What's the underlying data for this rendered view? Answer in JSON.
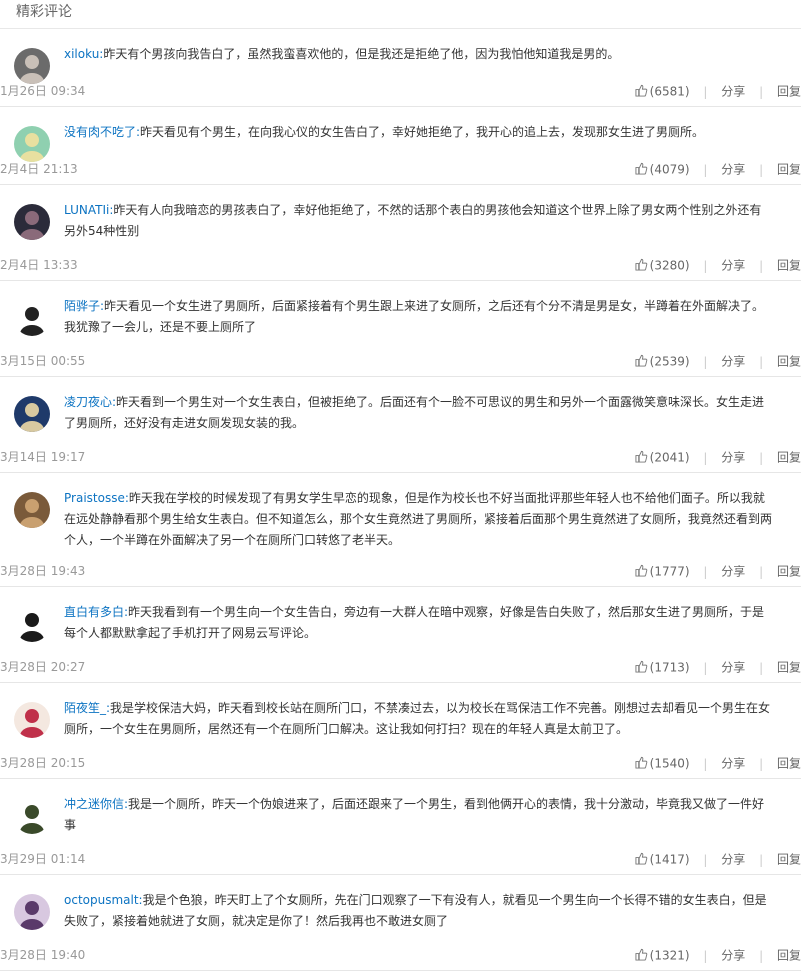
{
  "section_title": "精彩评论",
  "comments": [
    {
      "user": "xiloku:",
      "text": "昨天有个男孩向我告白了，虽然我蛮喜欢他的，但是我还是拒绝了他，因为我怕他知道我是男的。",
      "time": "1月26日 09:34",
      "likes": "(6581)",
      "share": "分享",
      "reply": "回复",
      "avatar_colors": [
        "#6b6b6b",
        "#c9c0b8"
      ]
    },
    {
      "user": "没有肉不吃了:",
      "text": "昨天看见有个男生，在向我心仪的女生告白了，幸好她拒绝了，我开心的追上去，发现那女生进了男厕所。",
      "time": "2月4日 21:13",
      "likes": "(4079)",
      "share": "分享",
      "reply": "回复",
      "avatar_colors": [
        "#8fd0b0",
        "#e8e0a0"
      ]
    },
    {
      "user": "LUNATIi:",
      "text": "昨天有人向我暗恋的男孩表白了，幸好他拒绝了，不然的话那个表白的男孩他会知道这个世界上除了男女两个性别之外还有另外54种性别",
      "time": "2月4日 13:33",
      "likes": "(3280)",
      "share": "分享",
      "reply": "回复",
      "avatar_colors": [
        "#2b2b3a",
        "#8a6a7a"
      ]
    },
    {
      "user": "陌骅子:",
      "text": "昨天看见一个女生进了男厕所，后面紧接着有个男生跟上来进了女厕所，之后还有个分不清是男是女，半蹲着在外面解决了。我犹豫了一会儿，还是不要上厕所了",
      "time": "3月15日 00:55",
      "likes": "(2539)",
      "share": "分享",
      "reply": "回复",
      "avatar_colors": [
        "#ffffff",
        "#222222"
      ]
    },
    {
      "user": "凌刀夜心:",
      "text": "昨天看到一个男生对一个女生表白，但被拒绝了。后面还有个一脸不可思议的男生和另外一个面露微笑意味深长。女生走进了男厕所，还好没有走进女厕发现女装的我。",
      "time": "3月14日 19:17",
      "likes": "(2041)",
      "share": "分享",
      "reply": "回复",
      "avatar_colors": [
        "#1f3a6a",
        "#d8c9a0"
      ]
    },
    {
      "user": "Praistosse:",
      "text": "昨天我在学校的时候发现了有男女学生早恋的现象，但是作为校长也不好当面批评那些年轻人也不给他们面子。所以我就在远处静静看那个男生给女生表白。但不知道怎么，那个女生竟然进了男厕所，紧接着后面那个男生竟然进了女厕所，我竟然还看到两个人，一个半蹲在外面解决了另一个在厕所门口转悠了老半天。",
      "time": "3月28日 19:43",
      "likes": "(1777)",
      "share": "分享",
      "reply": "回复",
      "avatar_colors": [
        "#7a5a3a",
        "#c9a070"
      ]
    },
    {
      "user": "直白有多白:",
      "text": "昨天我看到有一个男生向一个女生告白，旁边有一大群人在暗中观察，好像是告白失败了，然后那女生进了男厕所，于是每个人都默默拿起了手机打开了网易云写评论。",
      "time": "3月28日 20:27",
      "likes": "(1713)",
      "share": "分享",
      "reply": "回复",
      "avatar_colors": [
        "#ffffff",
        "#1a1a1a"
      ]
    },
    {
      "user": "陌夜笙_:",
      "text": "我是学校保洁大妈，昨天看到校长站在厕所门口，不禁凑过去，以为校长在骂保洁工作不完善。刚想过去却看见一个男生在女厕所，一个女生在男厕所，居然还有一个在厕所门口解决。这让我如何打扫？现在的年轻人真是太前卫了。",
      "time": "3月28日 20:15",
      "likes": "(1540)",
      "share": "分享",
      "reply": "回复",
      "avatar_colors": [
        "#f4e8e0",
        "#c0304a"
      ]
    },
    {
      "user": "冲之迷你信:",
      "text": "我是一个厕所，昨天一个伪娘进来了，后面还跟来了一个男生，看到他俩开心的表情，我十分激动，毕竟我又做了一件好事",
      "time": "3月29日 01:14",
      "likes": "(1417)",
      "share": "分享",
      "reply": "回复",
      "avatar_colors": [
        "#ffffff",
        "#3a4a2a"
      ]
    },
    {
      "user": "octopusmalt:",
      "text": "我是个色狼，昨天盯上了个女厕所，先在门口观察了一下有没有人，就看见一个男生向一个长得不错的女生表白，但是失败了，紧接着她就进了女厕，就决定是你了！然后我再也不敢进女厕了",
      "time": "3月28日 19:40",
      "likes": "(1321)",
      "share": "分享",
      "reply": "回复",
      "avatar_colors": [
        "#d8c8e0",
        "#5a3a6a"
      ]
    }
  ]
}
